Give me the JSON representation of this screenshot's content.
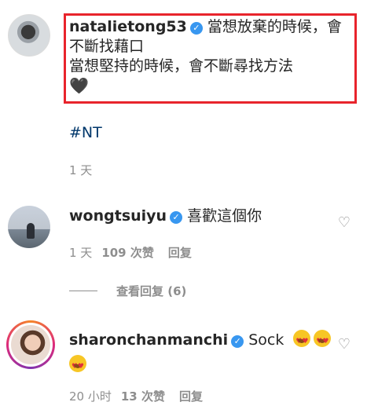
{
  "comments": [
    {
      "username": "natalietong53",
      "line1": "當想放棄的時候，會不斷找藉口",
      "line2": "當想堅持的時候，會不斷尋找方法",
      "emoji": "🖤",
      "hashtag": "#NT",
      "time": "1 天"
    },
    {
      "username": "wongtsuiyu",
      "text": "喜歡這個你",
      "time": "1 天",
      "likes": "109 次赞",
      "reply": "回复",
      "view_replies": "查看回复 (6)"
    },
    {
      "username": "sharonchanmanchi",
      "text": "Sock",
      "time": "20 小时",
      "likes": "13 次赞",
      "reply": "回复"
    }
  ],
  "icons": {
    "verified": "✓",
    "heart_outline": "♡"
  },
  "colors": {
    "highlight": "#e8242c",
    "verified": "#3897f0",
    "hashtag": "#00376b",
    "meta": "#8e8e8e"
  }
}
